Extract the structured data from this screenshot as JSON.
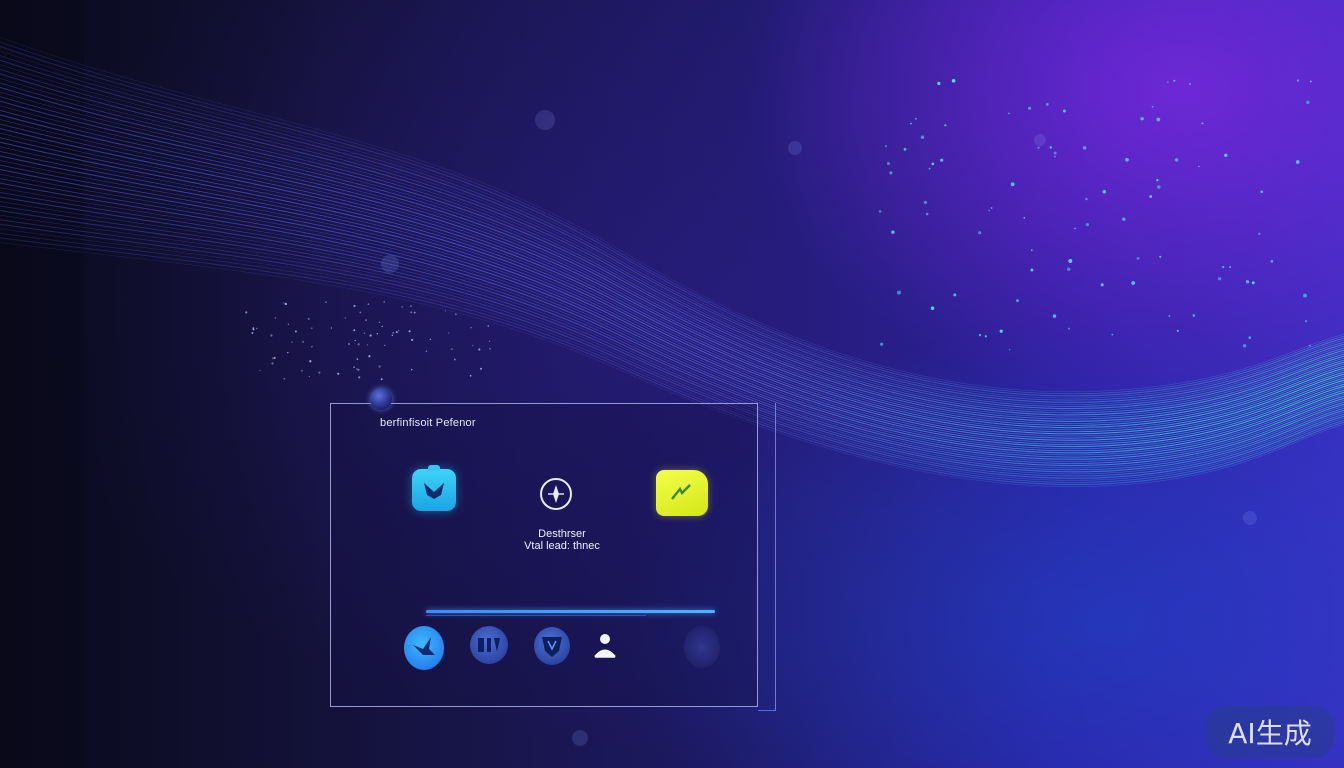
{
  "panel": {
    "title": "berfinfisoit Pefenor",
    "center_text_line1": "Desthrser",
    "center_text_line2": "Vtal lead: thnec",
    "progress_fraction": 1.0
  },
  "icons": {
    "top": [
      "download-app-icon",
      "compass-icon",
      "yellow-badge-icon"
    ],
    "bottom": [
      "bird-icon",
      "circle-logo-icon",
      "shield-logo-icon",
      "user-icon"
    ]
  },
  "watermark": {
    "text": "AI生成"
  },
  "colors": {
    "background_dark": "#100f2c",
    "background_purple": "#6a2ee0",
    "wave_blue": "#5a6cff",
    "wave_green": "#3ff0c0",
    "accent_cyan": "#2cc4f2",
    "accent_yellow": "#e6f52a",
    "panel_border": "#bec8ff"
  }
}
